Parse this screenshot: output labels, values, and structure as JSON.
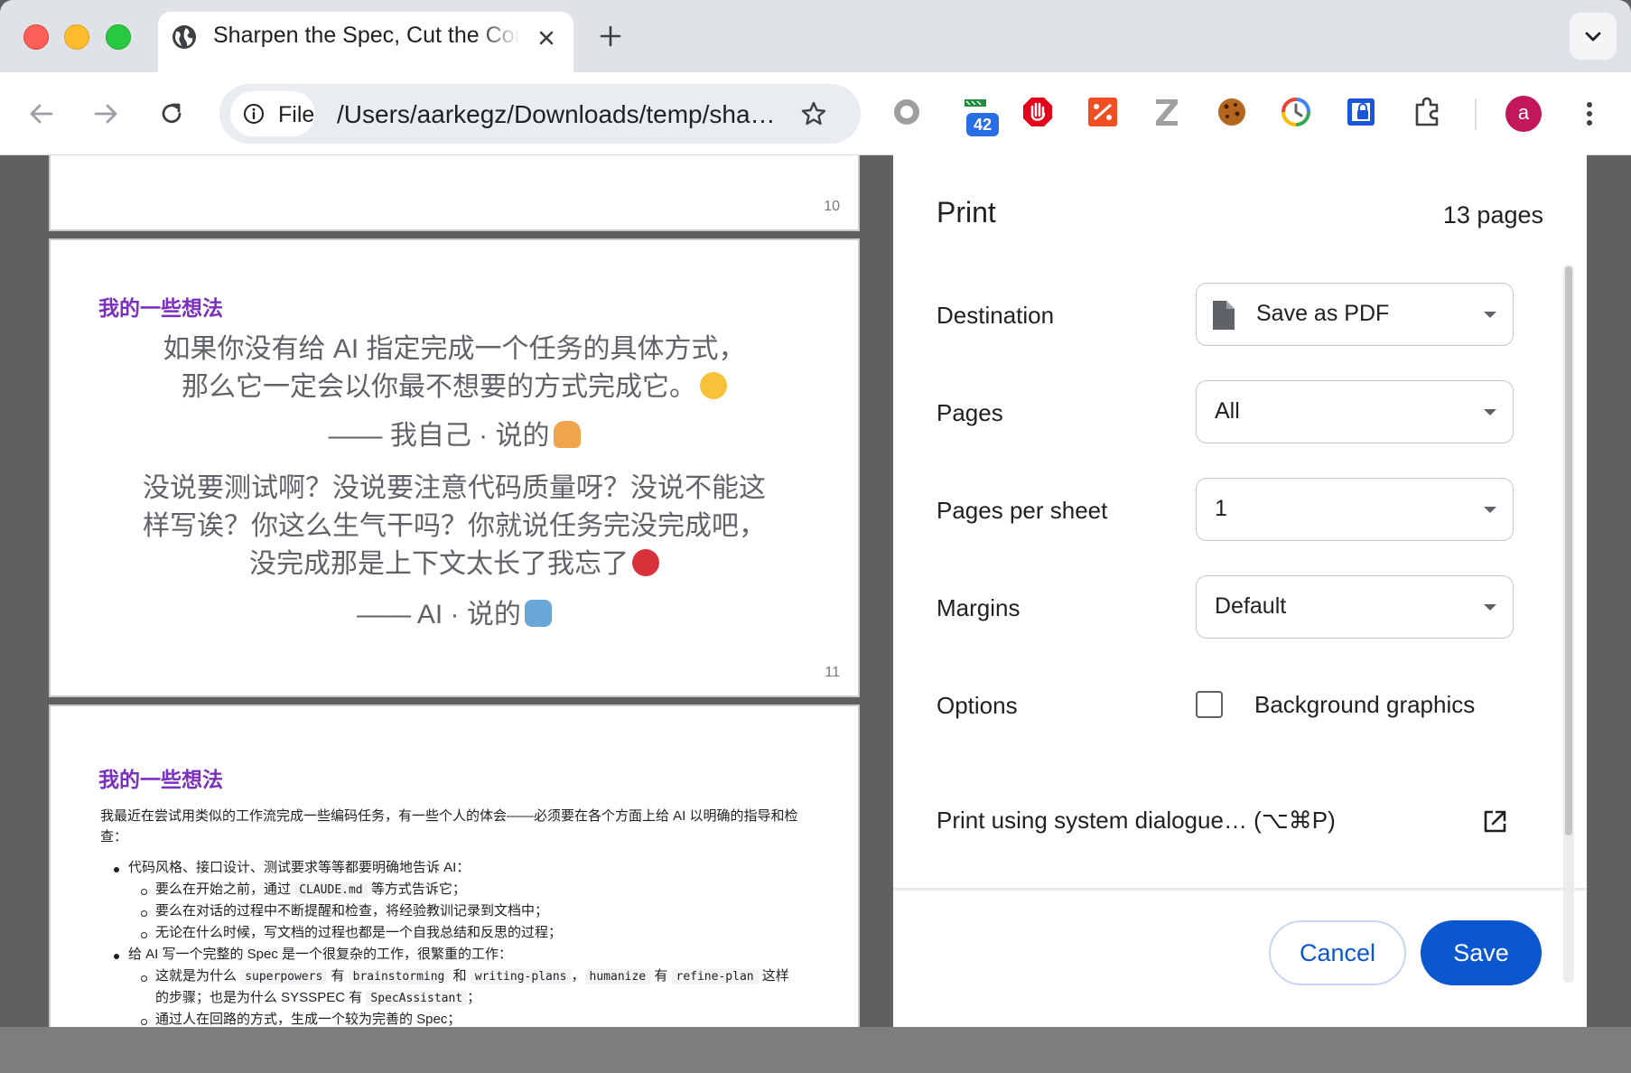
{
  "tab": {
    "title": "Sharpen the Spec, Cut the Context"
  },
  "toolbar": {
    "chip_label": "File",
    "url": "/Users/aarkegz/Downloads/temp/sharpen-the-spec.html",
    "ext_badge": "42",
    "avatar_letter": "a"
  },
  "preview": {
    "page10": {
      "number": "10"
    },
    "page11": {
      "heading": "我的一些想法",
      "quote1_line1": "如果你没有给 AI 指定完成一个任务的具体方式，",
      "quote1_line2": "那么它一定会以你最不想要的方式完成它。",
      "attribution1": "—— 我自己 · 说的",
      "quote2_line1": "没说要测试啊？没说要注意代码质量呀？没说不能这",
      "quote2_line2": "样写诶？你这么生气干吗？你就说任务完没完成吧，",
      "quote2_line3": "没完成那是上下文太长了我忘了",
      "attribution2": "—— AI · 说的",
      "number": "11"
    },
    "page12": {
      "heading": "我的一些想法",
      "intro": "我最近在尝试用类似的工作流完成一些编码任务，有一些个人的体会——必须要在各个方面上给 AI 以明确的指导和检查：",
      "b1": "代码风格、接口设计、测试要求等等都要明确地告诉 AI：",
      "b1_1a": "要么在开始之前，通过",
      "b1_1code": "CLAUDE.md",
      "b1_1b": "等方式告诉它；",
      "b1_2": "要么在对话的过程中不断提醒和检查，将经验教训记录到文档中；",
      "b1_3": "无论在什么时候，写文档的过程也都是一个自我总结和反思的过程；",
      "b2": "给 AI 写一个完整的 Spec 是一个很复杂的工作，很繁重的工作：",
      "b2_1a": "这就是为什么",
      "c_superpowers": "superpowers",
      "w_you1": "有",
      "c_brainstorming": "brainstorming",
      "w_he": "和",
      "c_writingplans": "writing-plans",
      "w_comma": "，",
      "c_humanize": "humanize",
      "w_you2": "有",
      "c_refineplan": "refine-plan",
      "w_zheyang": "这样",
      "b2_1b": "的步骤；也是为什么 SYSSPEC 有",
      "c_specassistant": "SpecAssistant",
      "w_semi": "；",
      "b2_2": "通过人在回路的方式，生成一个较为完善的 Spec；"
    }
  },
  "print": {
    "title": "Print",
    "page_count": "13 pages",
    "destination_label": "Destination",
    "destination_value": "Save as PDF",
    "pages_label": "Pages",
    "pages_value": "All",
    "pps_label": "Pages per sheet",
    "pps_value": "1",
    "margins_label": "Margins",
    "margins_value": "Default",
    "options_label": "Options",
    "bg_graphics_label": "Background graphics",
    "bg_graphics_checked": false,
    "system_dialog_label": "Print using system dialogue… (⌥⌘P)",
    "cancel_label": "Cancel",
    "save_label": "Save",
    "accent_color": "#0b57d0"
  }
}
